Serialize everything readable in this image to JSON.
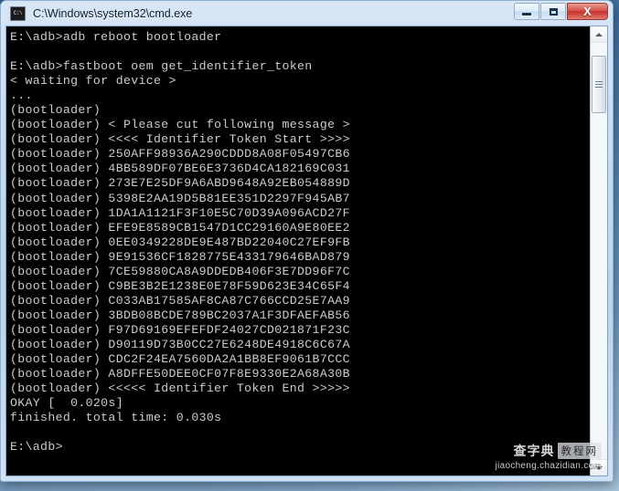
{
  "window": {
    "title": "C:\\Windows\\system32\\cmd.exe",
    "icon_name": "cmd-icon",
    "icon_glyph": "C:\\",
    "buttons": {
      "minimize": "Minimize",
      "maximize": "Maximize",
      "close": "X"
    }
  },
  "console": {
    "foreground_color": "#cccccc",
    "background_color": "#000000",
    "lines": [
      "E:\\adb>adb reboot bootloader",
      "",
      "E:\\adb>fastboot oem get_identifier_token",
      "< waiting for device >",
      "...",
      "(bootloader)",
      "(bootloader) < Please cut following message >",
      "(bootloader) <<<< Identifier Token Start >>>>",
      "(bootloader) 250AFF98936A290CDDD8A08F05497CB6",
      "(bootloader) 4BB589DF07BE6E3736D4CA182169C031",
      "(bootloader) 273E7E25DF9A6ABD9648A92EB054889D",
      "(bootloader) 5398E2AA19D5B81EE351D2297F945AB7",
      "(bootloader) 1DA1A1121F3F10E5C70D39A096ACD27F",
      "(bootloader) EFE9E8589CB1547D1CC29160A9E80EE2",
      "(bootloader) 0EE0349228DE9E487BD22040C27EF9FB",
      "(bootloader) 9E91536CF1828775E433179646BAD879",
      "(bootloader) 7CE59880CA8A9DDEDB406F3E7DD96F7C",
      "(bootloader) C9BE3B2E1238E0E78F59D623E34C65F4",
      "(bootloader) C033AB17585AF8CA87C766CCD25E7AA9",
      "(bootloader) 3BDB08BCDE789BC2037A1F3DFAEFAB56",
      "(bootloader) F97D69169EFEFDF24027CD021871F23C",
      "(bootloader) D90119D73B0CC27E6248DE4918C6C67A",
      "(bootloader) CDC2F24EA7560DA2A1BB8EF9061B7CCC",
      "(bootloader) A8DFFE50DEE0CF07F8E9330E2A68A30B",
      "(bootloader) <<<<< Identifier Token End >>>>>",
      "OKAY [  0.020s]",
      "finished. total time: 0.030s",
      "",
      "E:\\adb>"
    ]
  },
  "scrollbar": {
    "up_arrow": "scroll-up",
    "down_arrow": "scroll-down",
    "thumb": "scroll-thumb"
  },
  "watermark": {
    "brand": "查字典",
    "badge": "教程网",
    "url": "jiaocheng.chazidian.com"
  }
}
